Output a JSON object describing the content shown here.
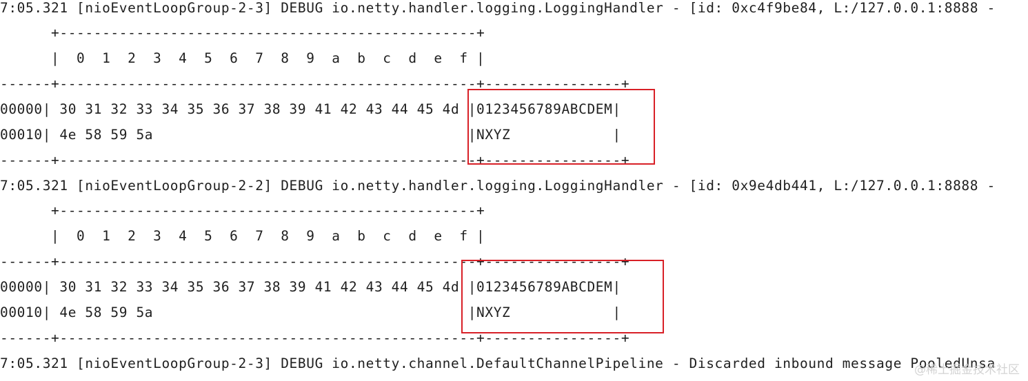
{
  "console": {
    "lines": [
      "7:05.321 [nioEventLoopGroup-2-3] DEBUG io.netty.handler.logging.LoggingHandler - [id: 0xc4f9be84, L:/127.0.0.1:8888 -",
      "      +-------------------------------------------------+",
      "      |  0  1  2  3  4  5  6  7  8  9  a  b  c  d  e  f |",
      "------+-------------------------------------------------+----------------+",
      "00000| 30 31 32 33 34 35 36 37 38 39 41 42 43 44 45 4d |0123456789ABCDEM|",
      "00010| 4e 58 59 5a                                     |NXYZ            |",
      "------+-------------------------------------------------+----------------+",
      "7:05.321 [nioEventLoopGroup-2-2] DEBUG io.netty.handler.logging.LoggingHandler - [id: 0x9e4db441, L:/127.0.0.1:8888 -",
      "      +-------------------------------------------------+",
      "      |  0  1  2  3  4  5  6  7  8  9  a  b  c  d  e  f |",
      "------+-------------------------------------------------+----------------+",
      "00000| 30 31 32 33 34 35 36 37 38 39 41 42 43 44 45 4d |0123456789ABCDEM|",
      "00010| 4e 58 59 5a                                     |NXYZ            |",
      "------+-------------------------------------------------+----------------+",
      "7:05.321 [nioEventLoopGroup-2-3] DEBUG io.netty.channel.DefaultChannelPipeline - Discarded inbound message PooledUnsa"
    ],
    "watermark": "@稀土掘金技术社区"
  },
  "colors": {
    "text": "#1f1f1f",
    "highlight": "#d81f26",
    "background": "#ffffff"
  }
}
